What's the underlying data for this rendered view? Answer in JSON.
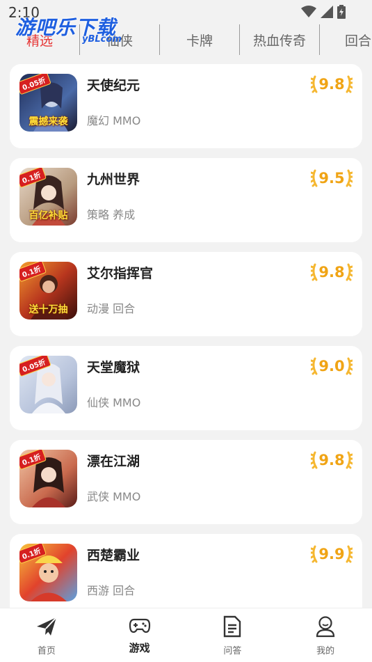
{
  "status_bar": {
    "time": "2:10"
  },
  "watermark": {
    "text": "游吧乐下载",
    "sub": "yBLcom"
  },
  "tabs": [
    {
      "label": "精选",
      "active": true
    },
    {
      "label": "仙侠",
      "active": false
    },
    {
      "label": "卡牌",
      "active": false
    },
    {
      "label": "热血传奇",
      "active": false
    },
    {
      "label": "回合",
      "active": false
    }
  ],
  "games": [
    {
      "name": "天使纪元",
      "tags": "魔幻 MMO",
      "score": "9.8",
      "badge": "0.05折",
      "promo": "震撼来袭"
    },
    {
      "name": "九州世界",
      "tags": "策略 养成",
      "score": "9.5",
      "badge": "0.1折",
      "promo": "百亿补贴"
    },
    {
      "name": "艾尔指挥官",
      "tags": "动漫 回合",
      "score": "9.8",
      "badge": "0.1折",
      "promo": "送十万抽"
    },
    {
      "name": "天堂魔狱",
      "tags": "仙侠 MMO",
      "score": "9.0",
      "badge": "0.05折",
      "promo": ""
    },
    {
      "name": "漂在江湖",
      "tags": "武侠 MMO",
      "score": "9.8",
      "badge": "0.1折",
      "promo": ""
    },
    {
      "name": "西楚霸业",
      "tags": "西游 回合",
      "score": "9.9",
      "badge": "0.1折",
      "promo": ""
    }
  ],
  "bottom_nav": [
    {
      "label": "首页",
      "icon": "paper-plane-icon"
    },
    {
      "label": "游戏",
      "icon": "gamepad-icon"
    },
    {
      "label": "问答",
      "icon": "document-icon"
    },
    {
      "label": "我的",
      "icon": "user-icon"
    }
  ],
  "colors": {
    "accent": "#e63434",
    "score": "#f0a415",
    "watermark": "#1e5fe0"
  }
}
